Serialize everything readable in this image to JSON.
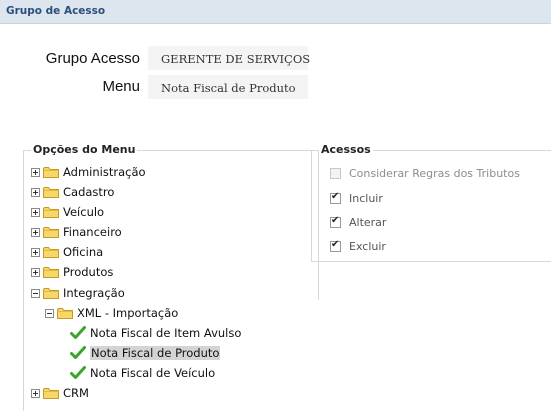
{
  "window": {
    "title": "Grupo de Acesso"
  },
  "form": {
    "group_label": "Grupo Acesso",
    "group_value": "GERENTE DE SERVIÇOS",
    "menu_label": "Menu",
    "menu_value": "Nota Fiscal de Produto"
  },
  "menu_tree": {
    "legend": "Opções do Menu",
    "items": [
      {
        "label": "Administração"
      },
      {
        "label": "Cadastro"
      },
      {
        "label": "Veículo"
      },
      {
        "label": "Financeiro"
      },
      {
        "label": "Oficina"
      },
      {
        "label": "Produtos"
      },
      {
        "label": "Integração"
      },
      {
        "label": "XML - Importação"
      },
      {
        "label": "Nota Fiscal de Item Avulso"
      },
      {
        "label": "Nota Fiscal de Produto",
        "selected": true
      },
      {
        "label": "Nota Fiscal de Veículo"
      },
      {
        "label": "CRM"
      }
    ]
  },
  "access": {
    "legend": "Acessos",
    "options": [
      {
        "label": "Considerar Regras dos Tributos",
        "checked": false,
        "enabled": false
      },
      {
        "label": "Incluir",
        "checked": true,
        "enabled": true
      },
      {
        "label": "Alterar",
        "checked": true,
        "enabled": true
      },
      {
        "label": "Excluir",
        "checked": true,
        "enabled": true
      }
    ]
  },
  "colors": {
    "titlebar_bg": "#dde5ee",
    "title_text": "#2a4f7c",
    "folder": "#f2cf5b",
    "check": "#3aa52a",
    "selected_bg": "#d4d4d4"
  }
}
